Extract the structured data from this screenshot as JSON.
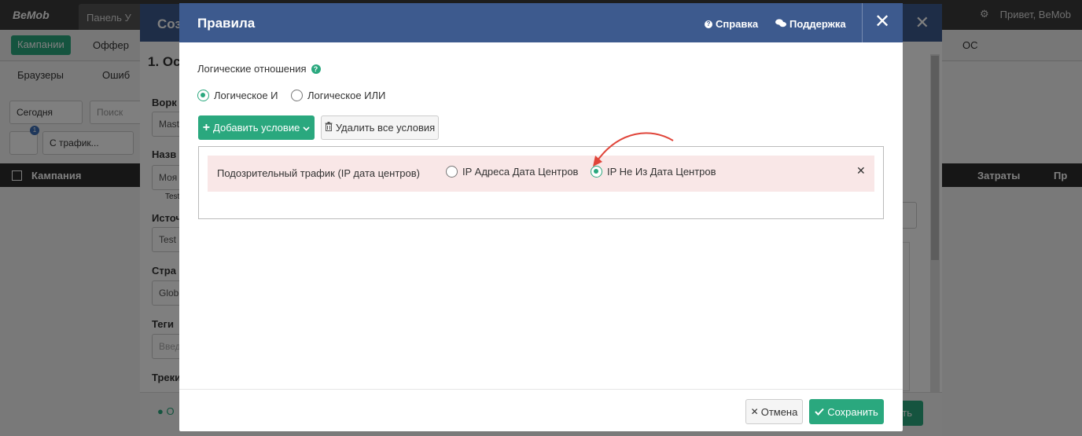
{
  "app": {
    "logo": "BeMob",
    "tab_dashboard": "Панель У",
    "greeting": "Привет, BeMob",
    "nav_campaigns": "Кампании",
    "nav_offers": "Оффер",
    "nav_os": "ОС",
    "filter_browsers": "Браузеры",
    "filter_errors": "Ошиб",
    "date_range": "Сегодня",
    "search_placeholder": "Поиск",
    "filter_badge": "1",
    "traffic_filter": "С трафик...",
    "table_col_campaign": "Кампания",
    "table_col_costs": "Затраты",
    "table_col_p": "Пр"
  },
  "bg_modal": {
    "title": "Соз",
    "section": "1. Ос",
    "label_workspace": "Ворк",
    "value_workspace": "Mast",
    "label_name": "Назв",
    "value_name": "Моя",
    "hint_name": "Test",
    "label_source": "Источ",
    "value_source": "Test",
    "label_country": "Стра",
    "value_country": "Glob",
    "label_tags": "Теги",
    "placeholder_tags": "Введ",
    "label_tracking": "Треки",
    "footer_status": "О",
    "footer_save": "ить"
  },
  "modal": {
    "title": "Правила",
    "help_label": "Справка",
    "support_label": "Поддержка",
    "logic_label": "Логические отношения",
    "logic_and": "Логическое И",
    "logic_or": "Логическое ИЛИ",
    "logic_selected": "and",
    "add_condition": "Добавить условие",
    "delete_all": "Удалить все условия",
    "cancel": "Отмена",
    "save": "Сохранить"
  },
  "conditions": [
    {
      "label": "Подозрительный трафик (IP дата центров)",
      "option_a": "IP Адреса Дата Центров",
      "option_b": "IP Не Из Дата Центров",
      "selected": "option_b"
    }
  ],
  "colors": {
    "header": "#3d5a8e",
    "accent": "#2aa87e",
    "condition_row": "#f9e7e7",
    "annotation_arrow": "#e0453a"
  }
}
